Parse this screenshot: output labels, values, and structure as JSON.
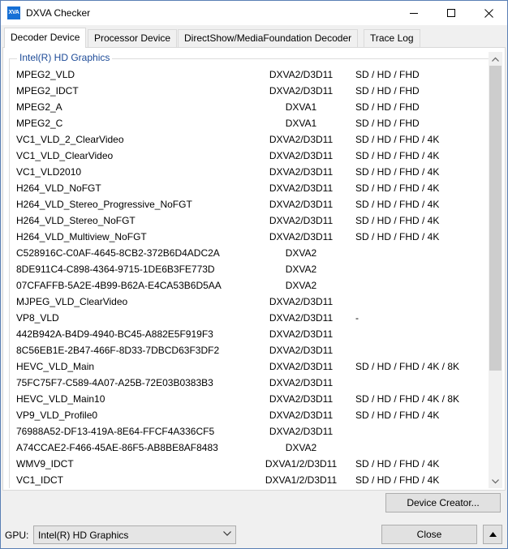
{
  "window": {
    "title": "DXVA Checker",
    "icon_text": "XVA"
  },
  "tabs": [
    {
      "label": "Decoder Device",
      "active": true
    },
    {
      "label": "Processor Device",
      "active": false
    },
    {
      "label": "DirectShow/MediaFoundation Decoder",
      "active": false
    },
    {
      "label": "Trace Log",
      "active": false
    }
  ],
  "group": {
    "label": "Intel(R) HD Graphics"
  },
  "decoders": [
    {
      "name": "MPEG2_VLD",
      "api": "DXVA2/D3D11",
      "res": "SD / HD / FHD"
    },
    {
      "name": "MPEG2_IDCT",
      "api": "DXVA2/D3D11",
      "res": "SD / HD / FHD"
    },
    {
      "name": "MPEG2_A",
      "api": "DXVA1",
      "res": "SD / HD / FHD"
    },
    {
      "name": "MPEG2_C",
      "api": "DXVA1",
      "res": "SD / HD / FHD"
    },
    {
      "name": "VC1_VLD_2_ClearVideo",
      "api": "DXVA2/D3D11",
      "res": "SD / HD / FHD / 4K"
    },
    {
      "name": "VC1_VLD_ClearVideo",
      "api": "DXVA2/D3D11",
      "res": "SD / HD / FHD / 4K"
    },
    {
      "name": "VC1_VLD2010",
      "api": "DXVA2/D3D11",
      "res": "SD / HD / FHD / 4K"
    },
    {
      "name": "H264_VLD_NoFGT",
      "api": "DXVA2/D3D11",
      "res": "SD / HD / FHD / 4K"
    },
    {
      "name": "H264_VLD_Stereo_Progressive_NoFGT",
      "api": "DXVA2/D3D11",
      "res": "SD / HD / FHD / 4K"
    },
    {
      "name": "H264_VLD_Stereo_NoFGT",
      "api": "DXVA2/D3D11",
      "res": "SD / HD / FHD / 4K"
    },
    {
      "name": "H264_VLD_Multiview_NoFGT",
      "api": "DXVA2/D3D11",
      "res": "SD / HD / FHD / 4K"
    },
    {
      "name": "C528916C-C0AF-4645-8CB2-372B6D4ADC2A",
      "api": "DXVA2",
      "res": ""
    },
    {
      "name": "8DE911C4-C898-4364-9715-1DE6B3FE773D",
      "api": "DXVA2",
      "res": ""
    },
    {
      "name": "07CFAFFB-5A2E-4B99-B62A-E4CA53B6D5AA",
      "api": "DXVA2",
      "res": ""
    },
    {
      "name": "MJPEG_VLD_ClearVideo",
      "api": "DXVA2/D3D11",
      "res": ""
    },
    {
      "name": "VP8_VLD",
      "api": "DXVA2/D3D11",
      "res": "-"
    },
    {
      "name": "442B942A-B4D9-4940-BC45-A882E5F919F3",
      "api": "DXVA2/D3D11",
      "res": ""
    },
    {
      "name": "8C56EB1E-2B47-466F-8D33-7DBCD63F3DF2",
      "api": "DXVA2/D3D11",
      "res": ""
    },
    {
      "name": "HEVC_VLD_Main",
      "api": "DXVA2/D3D11",
      "res": "SD / HD / FHD / 4K / 8K"
    },
    {
      "name": "75FC75F7-C589-4A07-A25B-72E03B0383B3",
      "api": "DXVA2/D3D11",
      "res": ""
    },
    {
      "name": "HEVC_VLD_Main10",
      "api": "DXVA2/D3D11",
      "res": "SD / HD / FHD / 4K / 8K"
    },
    {
      "name": "VP9_VLD_Profile0",
      "api": "DXVA2/D3D11",
      "res": "SD / HD / FHD / 4K"
    },
    {
      "name": "76988A52-DF13-419A-8E64-FFCF4A336CF5",
      "api": "DXVA2/D3D11",
      "res": ""
    },
    {
      "name": "A74CCAE2-F466-45AE-86F5-AB8BE8AF8483",
      "api": "DXVA2",
      "res": ""
    },
    {
      "name": "WMV9_IDCT",
      "api": "DXVA1/2/D3D11",
      "res": "SD / HD / FHD / 4K"
    },
    {
      "name": "VC1_IDCT",
      "api": "DXVA1/2/D3D11",
      "res": "SD / HD / FHD / 4K"
    }
  ],
  "buttons": {
    "device_creator": "Device Creator...",
    "close": "Close"
  },
  "gpu": {
    "label": "GPU:",
    "selected": "Intel(R) HD Graphics"
  },
  "colors": {
    "accent_text": "#1c4a97",
    "icon_bg": "#1670d6"
  }
}
